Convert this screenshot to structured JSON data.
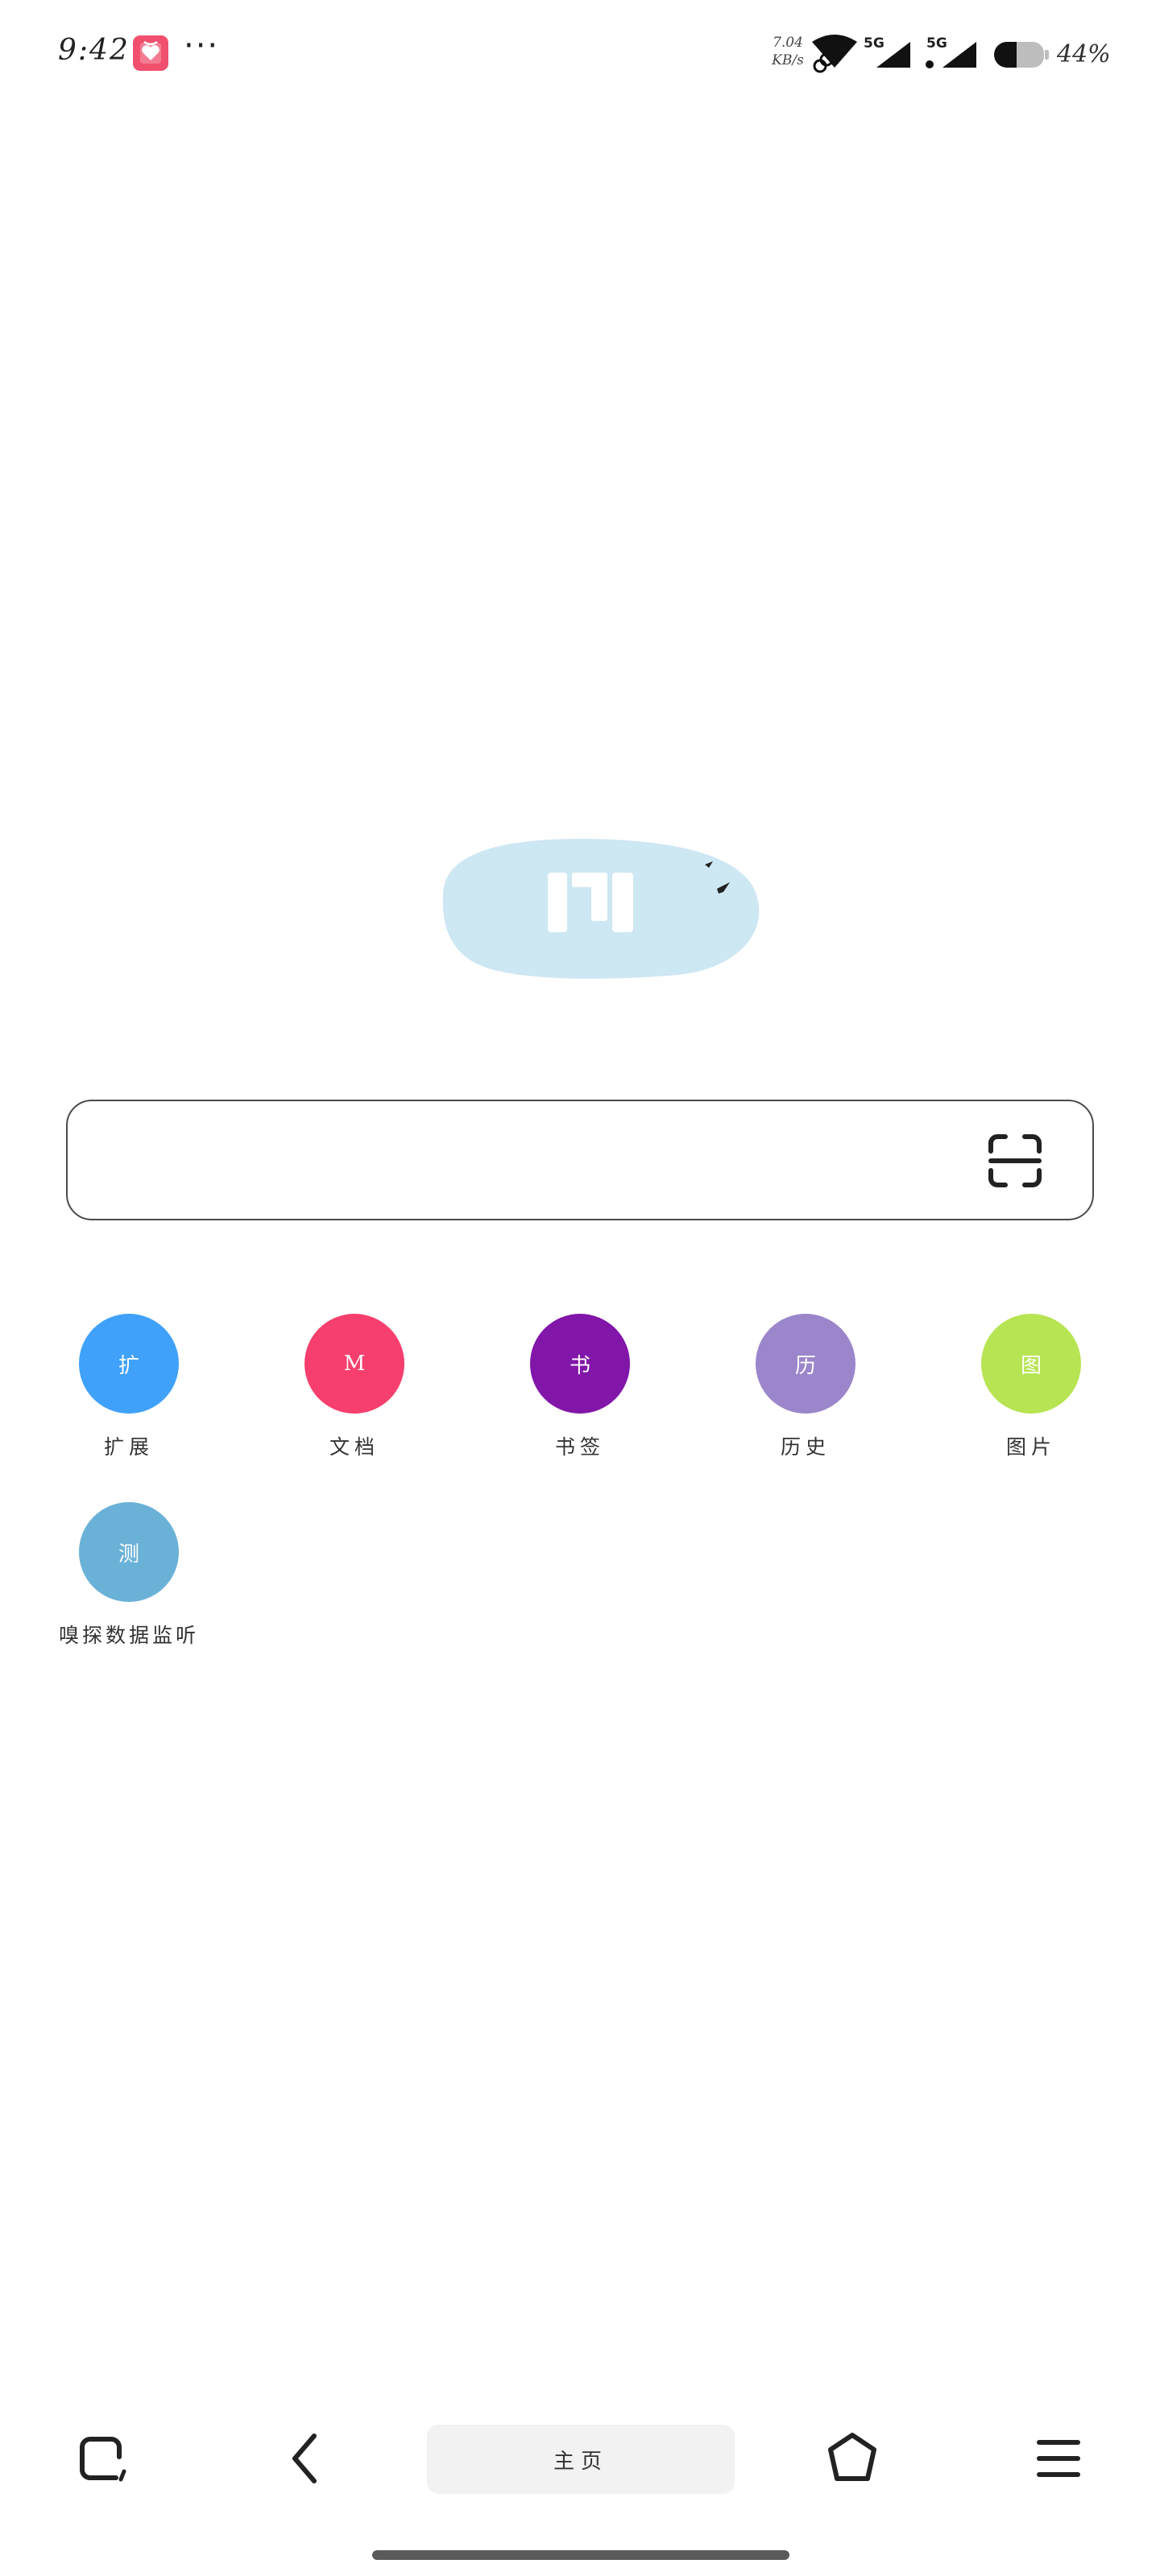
{
  "status_bar": {
    "time": "9:42",
    "more": "···",
    "speed_value": "7.04",
    "speed_unit": "KB/s",
    "network_a": "5G",
    "network_b": "5G",
    "battery": "44%",
    "battery_level": 0.44,
    "app_icon_color": "#F0506E"
  },
  "search": {
    "value": "",
    "placeholder": ""
  },
  "shortcuts": [
    {
      "glyph": "扩",
      "label": "扩展",
      "color": "#3FA1FA"
    },
    {
      "glyph": "M",
      "label": "文档",
      "color": "#F63F6E"
    },
    {
      "glyph": "书",
      "label": "书签",
      "color": "#8116A8"
    },
    {
      "glyph": "历",
      "label": "历史",
      "color": "#9B86CB"
    },
    {
      "glyph": "图",
      "label": "图片",
      "color": "#B7E452"
    },
    {
      "glyph": "测",
      "label": "嗅探数据监听",
      "color": "#6AB1D8"
    }
  ],
  "toolbar": {
    "center_label": "主页"
  },
  "colors": {
    "logo_bg": "#CDE7F3",
    "search_border": "#4A4A4A",
    "toolbar_center_bg": "#F2F2F2"
  },
  "icons": {
    "tabs": "tabs-icon",
    "back": "back-chevron-icon",
    "home": "hexagon-home-icon",
    "menu": "hamburger-menu-icon",
    "scan": "scan-icon"
  }
}
